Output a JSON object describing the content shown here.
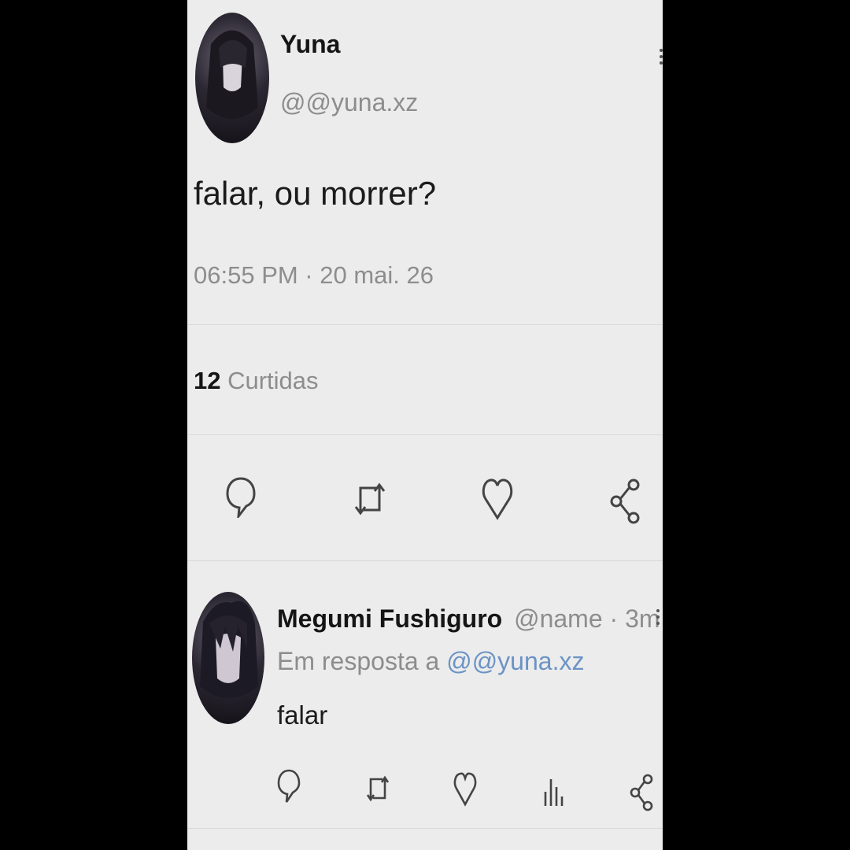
{
  "tweet": {
    "author_name": "Yuna",
    "author_handle": "@@yuna.xz",
    "text": "falar, ou morrer?",
    "timestamp": "06:55 PM · 20 mai. 26",
    "likes_count": "12",
    "likes_label": "Curtidas",
    "actions": [
      "reply-icon",
      "retweet-icon",
      "heart-icon",
      "share-icon"
    ]
  },
  "reply": {
    "author_name": "Megumi Fushiguro",
    "author_handle": "@name",
    "time_ago": "· 3m",
    "in_reply_prefix": "Em resposta a",
    "in_reply_handle": "@@yuna.xz",
    "text": "falar",
    "actions": [
      "reply-icon",
      "retweet-icon",
      "heart-icon",
      "stats-icon",
      "share-icon"
    ]
  },
  "colors": {
    "background": "#ececec",
    "text": "#151515",
    "muted": "#8d8d8d",
    "link": "#6b93c5"
  }
}
